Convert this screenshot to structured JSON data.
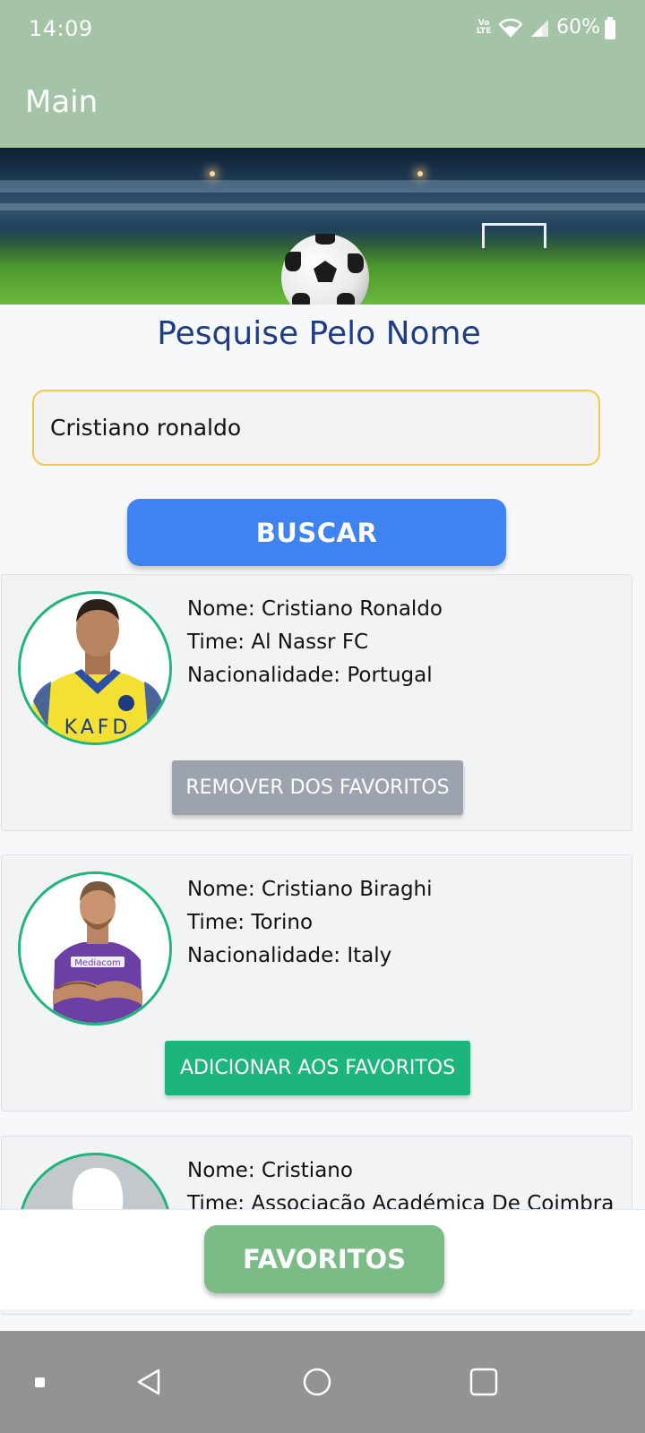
{
  "status_bar": {
    "time": "14:09",
    "volte": "Vo\nLTE",
    "battery": "60%"
  },
  "app_bar": {
    "title": "Main"
  },
  "search": {
    "heading": "Pesquise Pelo Nome",
    "value": "Cristiano ronaldo",
    "button_label": "BUSCAR"
  },
  "results": [
    {
      "name": "Nome: Cristiano Ronaldo",
      "team": "Time: Al Nassr FC",
      "nationality": "Nacionalidade: Portugal",
      "button_label": "REMOVER DOS FAVORITOS",
      "jersey_text": "KAFD"
    },
    {
      "name": "Nome: Cristiano Biraghi",
      "team": "Time: Torino",
      "nationality": "Nacionalidade: Italy",
      "button_label": "ADICIONAR AOS FAVORITOS",
      "jersey_text": "Mediacom"
    },
    {
      "name": "Nome: Cristiano",
      "team": "Time: Associação Académica De Coimbra"
    }
  ],
  "favorites_button": "FAVORITOS",
  "colors": {
    "appbar": "#a5c4a7",
    "heading": "#1f3c87",
    "buscar": "#3f82f2",
    "remove": "#9ca3ae",
    "add": "#1cb57b",
    "favoritos": "#7bbc86"
  },
  "icons": [
    "volte-icon",
    "wifi-icon",
    "signal-icon",
    "battery-icon",
    "nav-recents-dot-icon",
    "nav-back-icon",
    "nav-home-icon",
    "nav-overview-icon"
  ]
}
